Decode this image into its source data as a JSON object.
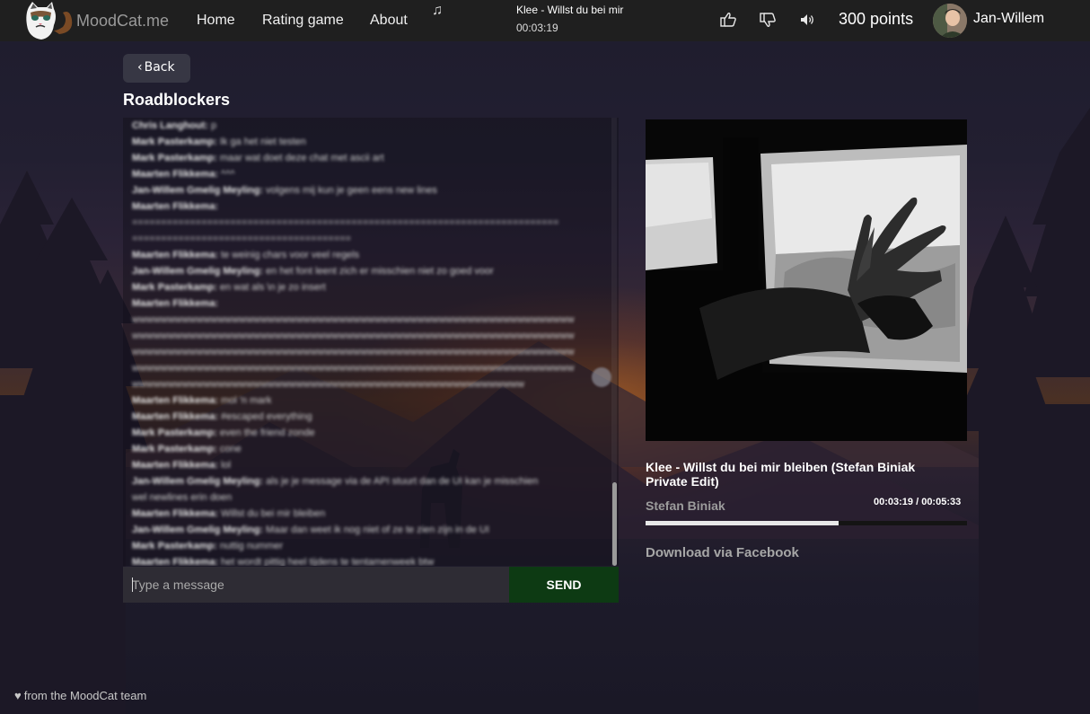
{
  "navbar": {
    "brand": "MoodCat.me",
    "links": [
      {
        "label": "Home"
      },
      {
        "label": "Rating game"
      },
      {
        "label": "About"
      }
    ],
    "music_icon": "music-note-icon",
    "now_playing": {
      "title": "Klee - Willst du bei mir",
      "time": "00:03:19"
    },
    "icons": [
      "thumbs-up-icon",
      "thumbs-down-icon",
      "volume-icon"
    ],
    "points": "300 points",
    "username": "Jan-Willem"
  },
  "page": {
    "back_label": "Back",
    "room_title": "Roadblockers"
  },
  "chat": {
    "messages": [
      {
        "author": "Chris Langhout:",
        "text": "p"
      },
      {
        "author": "Mark Pasterkamp:",
        "text": "Ik ga het niet testen"
      },
      {
        "author": "Mark Pasterkamp:",
        "text": "maar wat doet deze chat met ascii art"
      },
      {
        "author": "Maarten Flikkema:",
        "text": "^^^"
      },
      {
        "author": "Jan-Willem Gmelig Meyling:",
        "text": "volgens mij kun je geen eens new lines"
      },
      {
        "author": "Maarten Flikkema:",
        "text": ""
      },
      {
        "author": "",
        "text": "=========================================================================="
      },
      {
        "author": "",
        "text": "======================================"
      },
      {
        "author": "Maarten Flikkema:",
        "text": "te weinig chars voor veel regels"
      },
      {
        "author": "Jan-Willem Gmelig Meyling:",
        "text": "en het font leent zich er misschien niet zo goed voor"
      },
      {
        "author": "Mark Pasterkamp:",
        "text": "en wat als \\n je zo insert"
      },
      {
        "author": "Maarten Flikkema:",
        "text": ""
      },
      {
        "author": "",
        "text": "wwwwwwwwwwwwwwwwwwwwwwwwwwwwwwwwwwwwwwwwwwwwwwwwwwwwwwwwwwwwww"
      },
      {
        "author": "",
        "text": "wwwwwwwwwwwwwwwwwwwwwwwwwwwwwwwwwwwwwwwwwwwwwwwwwwwwwwwwwwwwww"
      },
      {
        "author": "",
        "text": "wwwwwwwwwwwwwwwwwwwwwwwwwwwwwwwwwwwwwwwwwwwwwwwwwwwwwwwwwwwwww"
      },
      {
        "author": "",
        "text": "wwwwwwwwwwwwwwwwwwwwwwwwwwwwwwwwwwwwwwwwwwwwwwwwwwwwwwwwwwwwww"
      },
      {
        "author": "",
        "text": "wwwwwwwwwwwwwwwwwwwwwwwwwwwwwwwwwwwwwwwwwwwwwwwwwwwwwww"
      },
      {
        "author": "Maarten Flikkema:",
        "text": "mol 'n mark"
      },
      {
        "author": "Maarten Flikkema:",
        "text": "#escaped everything"
      },
      {
        "author": "Mark Pasterkamp:",
        "text": "even the friend zonde"
      },
      {
        "author": "Mark Pasterkamp:",
        "text": "cone"
      },
      {
        "author": "Maarten Flikkema:",
        "text": "lol"
      },
      {
        "author": "Jan-Willem Gmelig Meyling:",
        "text": "als je je message via de API stuurt dan de UI kan je misschien"
      },
      {
        "author": "",
        "text": "wel newlines erin doen"
      },
      {
        "author": "Maarten Flikkema:",
        "text": "Willst du bei mir bleiben"
      },
      {
        "author": "Jan-Willem Gmelig Meyling:",
        "text": "Maar dan weet ik nog niet of ze te zien zijn in de UI"
      },
      {
        "author": "Mark Pasterkamp:",
        "text": "nuttig nummer"
      },
      {
        "author": "Maarten Flikkema:",
        "text": "het wordt pittig heel tijdens te tentamenweek btw"
      }
    ],
    "input_placeholder": "Type a message",
    "send_label": "SEND"
  },
  "player": {
    "track_title": "Klee - Willst du bei mir bleiben (Stefan Biniak Private Edit)",
    "artist": "Stefan Biniak",
    "time": "00:03:19 / 00:05:33",
    "progress_fraction": 0.6,
    "download_label": "Download via Facebook"
  },
  "footer": {
    "text": "from the MoodCat team"
  },
  "colors": {
    "navbar_bg": "#1f1f1f",
    "send_bg": "#0d3a13",
    "accent_progress": "#e8e8e8"
  }
}
